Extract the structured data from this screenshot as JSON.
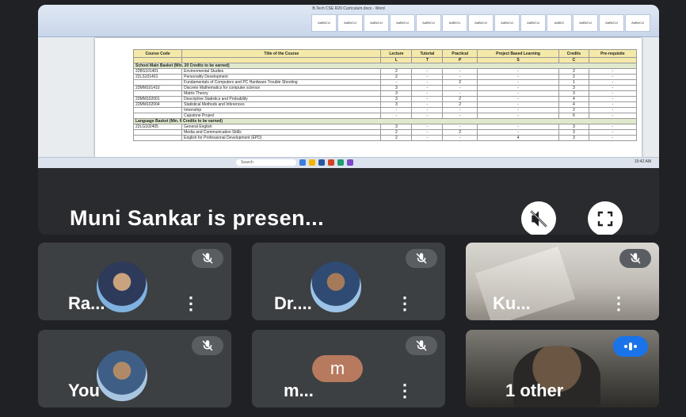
{
  "presentation": {
    "presenter_label": "Muni Sankar is presen...",
    "shared_screen": {
      "window_title": "B.Tech CSE R20 Curriculum.docx - Word",
      "style_gallery": [
        "AaBbCcI",
        "AaBbCcI",
        "AaBbCcI",
        "AaBbCcI",
        "AaBbCcI",
        "AaBbCc",
        "AaBbCcI",
        "AaBbCcI",
        "AaBbCcI",
        "AaBbC",
        "AaBbCcI",
        "AaBbCcI",
        "AaBbCcI"
      ],
      "table": {
        "headers": [
          "Course Code",
          "Title of the Course",
          "Lecture",
          "Tutorial",
          "Practical",
          "Project Based Learning",
          "Credits",
          "Pre-requisite"
        ],
        "subheaders": [
          "",
          "",
          "L",
          "T",
          "P",
          "S",
          "C",
          ""
        ],
        "rows": [
          {
            "type": "basket",
            "text": "School Main Basket (Min. 20 Credits to be earned)"
          },
          {
            "code": "22BS101401",
            "title": "Environmental Studies",
            "l": "2",
            "t": "-",
            "p": "-",
            "s": "-",
            "c": "2",
            "pre": "-"
          },
          {
            "code": "22LS101401",
            "title": "Personality Development",
            "l": "2",
            "t": "-",
            "p": "-",
            "s": "-",
            "c": "2",
            "pre": "-"
          },
          {
            "code": "",
            "title": "Fundamentals of Computers and PC Hardware Trouble Shooting",
            "l": "-",
            "t": "-",
            "p": "2",
            "s": "-",
            "c": "1",
            "pre": "-"
          },
          {
            "code": "22MM101410",
            "title": "Discrete Mathematics for computer science",
            "l": "3",
            "t": "-",
            "p": "-",
            "s": "-",
            "c": "3",
            "pre": "-"
          },
          {
            "code": "",
            "title": "Matrix Theory",
            "l": "3",
            "t": "-",
            "p": "-",
            "s": "-",
            "c": "3",
            "pre": "-"
          },
          {
            "code": "22MM102001",
            "title": "Descriptive Statistics and Probability",
            "l": "3",
            "t": "-",
            "p": "2",
            "s": "-",
            "c": "4",
            "pre": "-"
          },
          {
            "code": "22MM102004",
            "title": "Statistical Methods and Inferences",
            "l": "3",
            "t": "-",
            "p": "2",
            "s": "-",
            "c": "4",
            "pre": "-"
          },
          {
            "code": "",
            "title": "Internship",
            "l": "-",
            "t": "-",
            "p": "-",
            "s": "-",
            "c": "2",
            "pre": "-"
          },
          {
            "code": "",
            "title": "Capstone Project",
            "l": "-",
            "t": "-",
            "p": "-",
            "s": "-",
            "c": "6",
            "pre": "-"
          },
          {
            "type": "basket",
            "text": "Language Basket (Min. 6 Credits to be earned)"
          },
          {
            "code": "22LG102405",
            "title": "General English",
            "l": "3",
            "t": "-",
            "p": "-",
            "s": "-",
            "c": "3",
            "pre": "-"
          },
          {
            "code": "",
            "title": "Media and Communication Skills",
            "l": "2",
            "t": "-",
            "p": "2",
            "s": "-",
            "c": "3",
            "pre": "-"
          },
          {
            "code": "",
            "title": "English for Professional Development (EPD)",
            "l": "2",
            "t": "-",
            "p": "-",
            "s": "4",
            "c": "3",
            "pre": "-"
          }
        ]
      },
      "taskbar": {
        "search_placeholder": "Search",
        "time": "10:42 AM"
      }
    }
  },
  "participants": [
    {
      "name": "Ra...",
      "has_photo": true,
      "muted": true
    },
    {
      "name": "Dr....",
      "has_photo": true,
      "muted": true
    },
    {
      "name": "Ku...",
      "has_photo": false,
      "video": true,
      "muted": true
    },
    {
      "name": "You",
      "has_photo": true,
      "muted": true
    },
    {
      "name": "m...",
      "initial": "m",
      "avatar_color": "#b87a5e",
      "muted": true
    },
    {
      "name": "1 other",
      "video": true,
      "speaking": true
    }
  ],
  "colors": {
    "background": "#202124",
    "tile": "#3c4043",
    "speaking": "#1a73e8"
  }
}
